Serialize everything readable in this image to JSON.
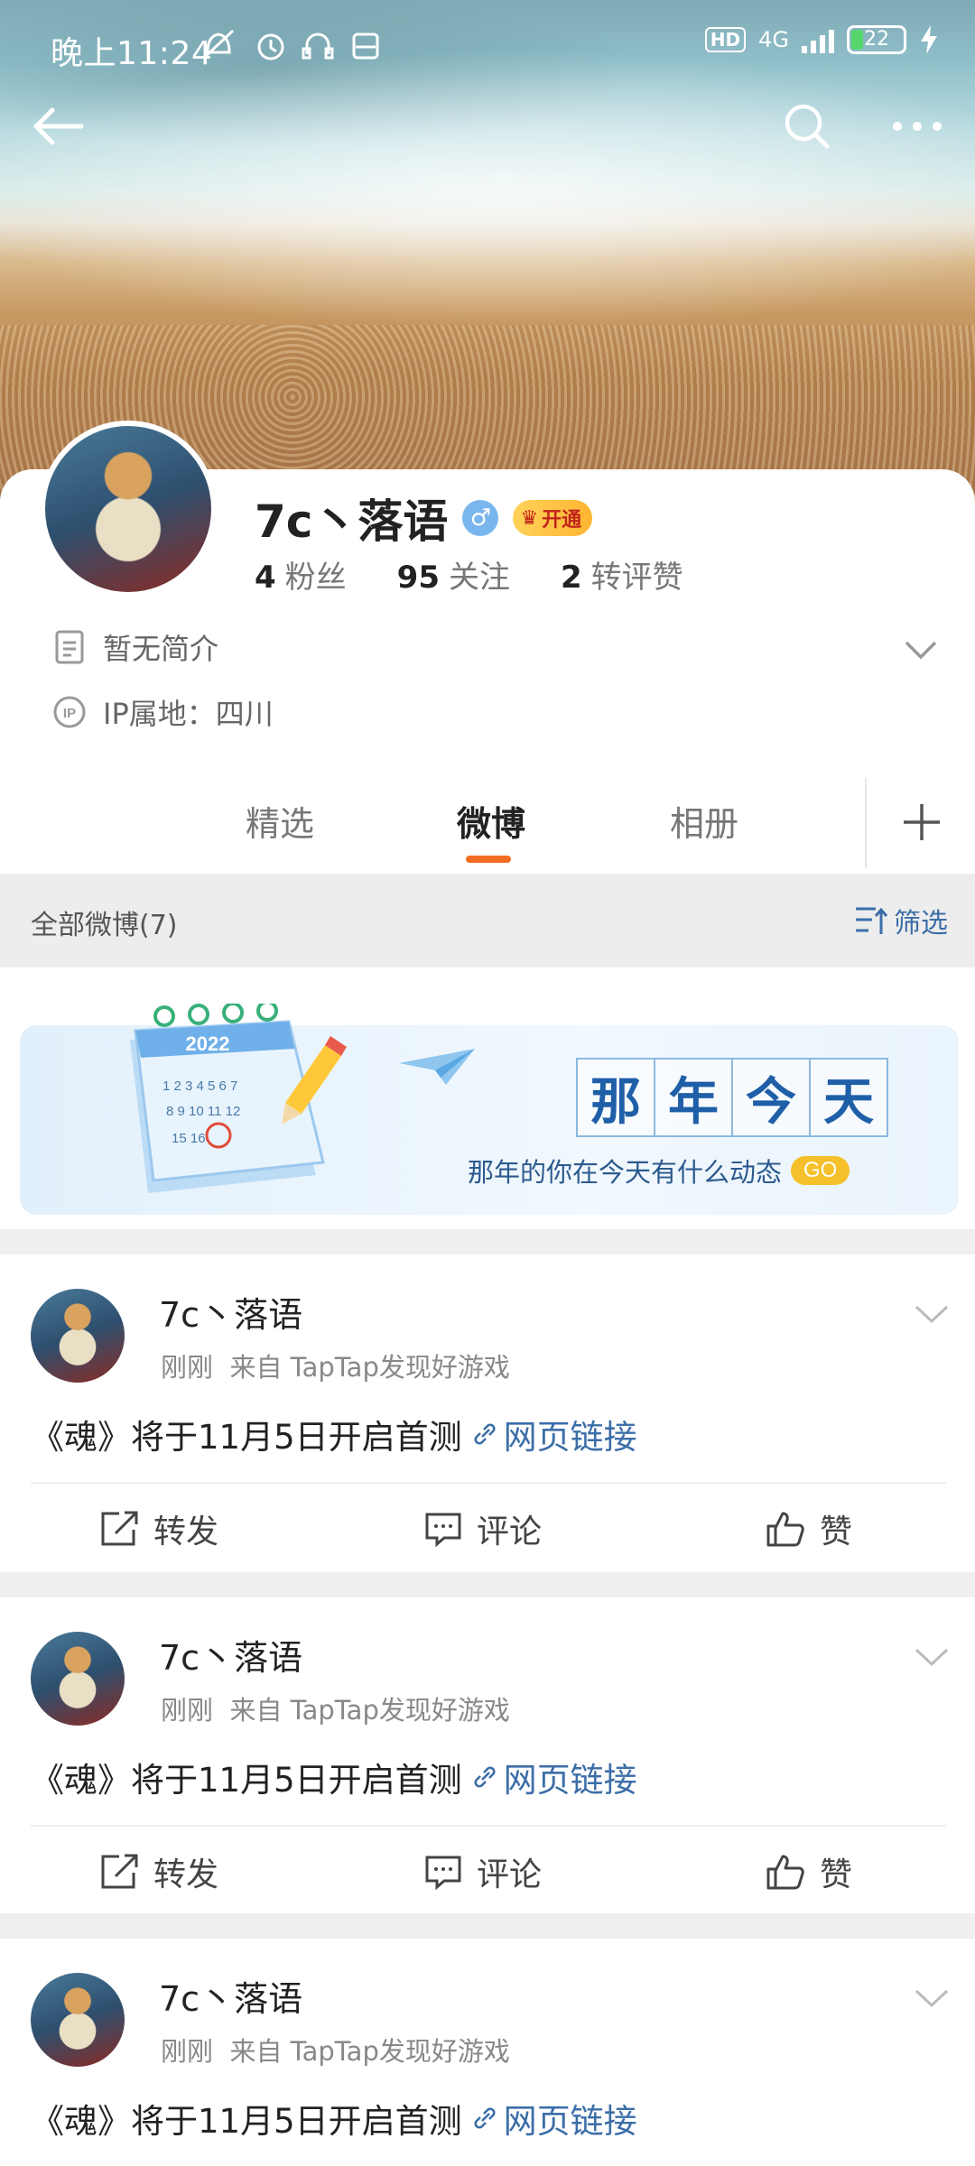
{
  "status_bar": {
    "time": "晚上11:24",
    "network": "4G",
    "hd": "HD",
    "battery": "22"
  },
  "profile": {
    "name": "7c丶落语",
    "vip_label": "开通",
    "stats": [
      {
        "value": "4",
        "label": "粉丝"
      },
      {
        "value": "95",
        "label": "关注"
      },
      {
        "value": "2",
        "label": "转评赞"
      }
    ],
    "bio": "暂无简介",
    "ip": "IP属地：四川"
  },
  "tabs": [
    "精选",
    "微博",
    "相册"
  ],
  "active_tab": "微博",
  "filter": {
    "left": "全部微博(7)",
    "right": "筛选"
  },
  "memory_banner": {
    "title_chars": [
      "那",
      "年",
      "今",
      "天"
    ],
    "subtitle": "那年的你在今天有什么动态",
    "go": "GO",
    "year": "2022"
  },
  "posts": [
    {
      "author": "7c丶落语",
      "time": "刚刚",
      "source": "来自 TapTap发现好游戏",
      "text": "《魂》将于11月5日开启首测",
      "link": "网页链接"
    },
    {
      "author": "7c丶落语",
      "time": "刚刚",
      "source": "来自 TapTap发现好游戏",
      "text": "《魂》将于11月5日开启首测",
      "link": "网页链接"
    },
    {
      "author": "7c丶落语",
      "time": "刚刚",
      "source": "来自 TapTap发现好游戏",
      "text": "《魂》将于11月5日开启首测",
      "link": "网页链接"
    }
  ],
  "actions": {
    "repost": "转发",
    "comment": "评论",
    "like": "赞"
  },
  "colors": {
    "accent": "#f26c22",
    "link": "#3c6ea8",
    "vip": "#ffc23a",
    "verified": "#7ab6ee"
  }
}
